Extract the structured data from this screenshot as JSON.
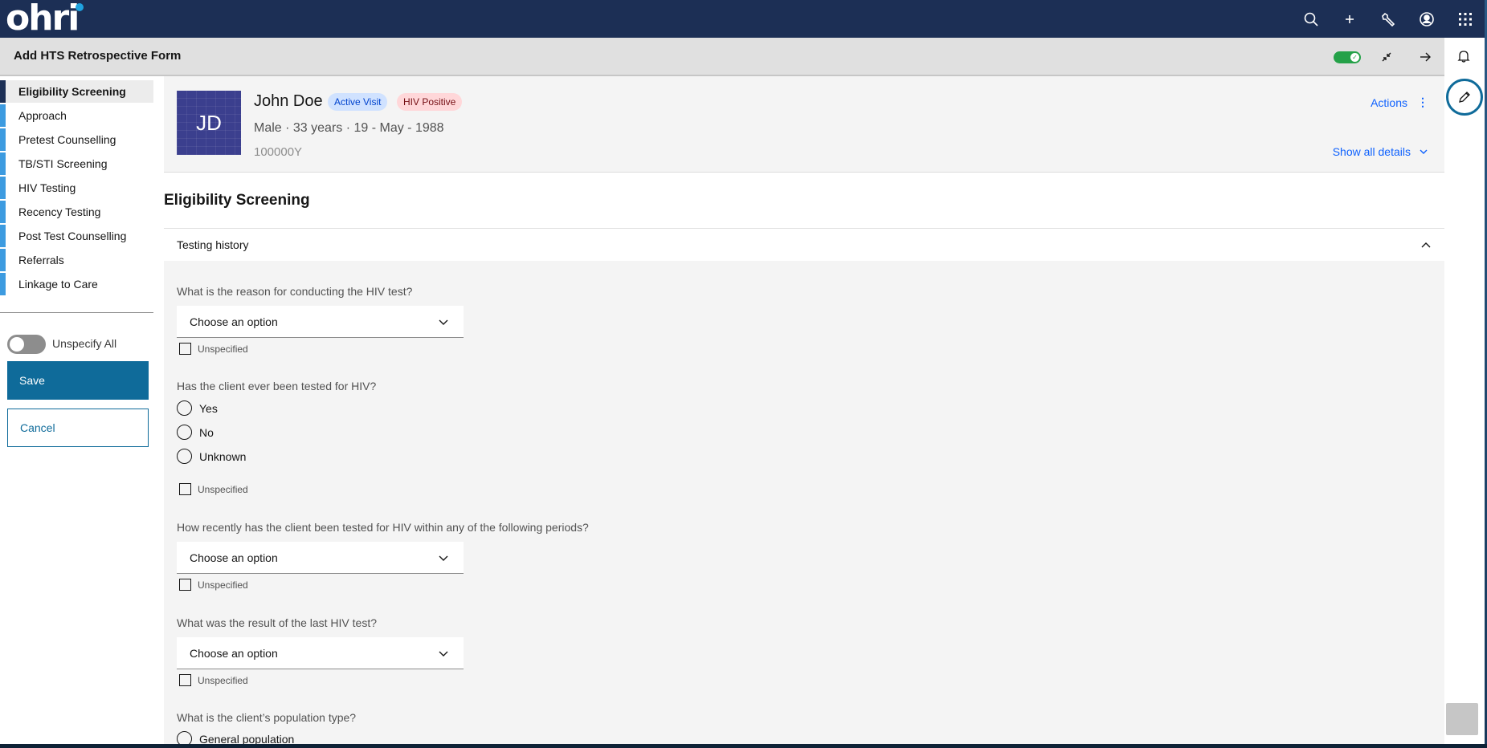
{
  "app": {
    "logo": "ohri",
    "nav_icons": [
      "search-icon",
      "add-icon",
      "wrench-icon",
      "user-avatar-icon",
      "app-switcher-icon"
    ]
  },
  "form_header": {
    "title": "Add HTS Retrospective Form",
    "toggle_state": "on",
    "accent_color": "#24a148"
  },
  "sidebar": {
    "items": [
      {
        "label": "Eligibility Screening",
        "active": true
      },
      {
        "label": "Approach",
        "active": false
      },
      {
        "label": "Pretest Counselling",
        "active": false
      },
      {
        "label": "TB/STI Screening",
        "active": false
      },
      {
        "label": "HIV Testing",
        "active": false
      },
      {
        "label": "Recency Testing",
        "active": false
      },
      {
        "label": "Post Test Counselling",
        "active": false
      },
      {
        "label": "Referrals",
        "active": false
      },
      {
        "label": "Linkage to Care",
        "active": false
      }
    ],
    "unspecify_all_label": "Unspecify All",
    "unspecify_all_state": "off",
    "save_label": "Save",
    "cancel_label": "Cancel"
  },
  "patient": {
    "initials": "JD",
    "name": "John Doe",
    "tags": [
      "Active Visit",
      "HIV Positive"
    ],
    "demographics": "Male · 33 years · 19 - May - 1988",
    "identifier": "100000Y",
    "actions_label": "Actions",
    "show_all_details_label": "Show all details"
  },
  "main": {
    "section_title": "Eligibility Screening",
    "accordion_title": "Testing history",
    "questions": [
      {
        "label": "What is the reason for conducting the HIV test?",
        "type": "select",
        "value": "Choose an option",
        "unspecified_label": "Unspecified"
      },
      {
        "label": "Has the client ever been tested for HIV?",
        "type": "radio",
        "options": [
          "Yes",
          "No",
          "Unknown"
        ],
        "unspecified_label": "Unspecified"
      },
      {
        "label": "How recently has the client been tested for HIV within any of the following periods?",
        "type": "select",
        "value": "Choose an option",
        "unspecified_label": "Unspecified"
      },
      {
        "label": "What was the result of the last HIV test?",
        "type": "select",
        "value": "Choose an option",
        "unspecified_label": "Unspecified"
      },
      {
        "label": "What is the client’s population type?",
        "type": "radio",
        "options": [
          "General population"
        ]
      }
    ]
  },
  "right_panel": {
    "icons": [
      "notification-bell-icon",
      "edit-pencil-icon"
    ]
  }
}
